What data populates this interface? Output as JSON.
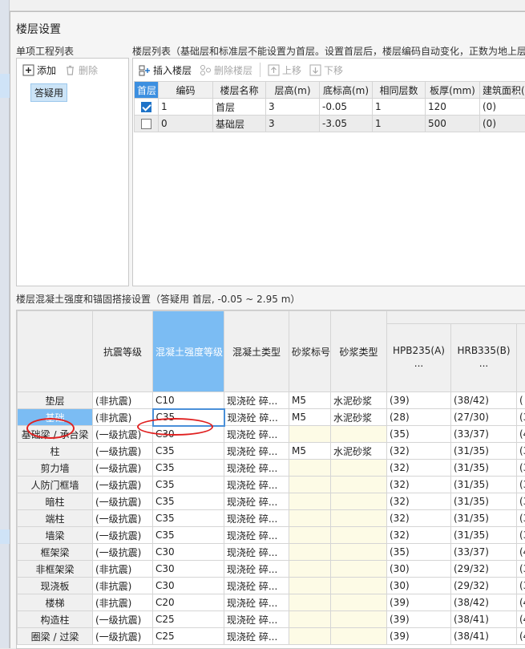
{
  "dialog": {
    "title": "楼层设置"
  },
  "project_list": {
    "label": "单项工程列表",
    "add_label": "添加",
    "delete_label": "删除",
    "items": [
      "答疑用"
    ]
  },
  "floor_list": {
    "label": "楼层列表（基础层和标准层不能设置为首层。设置首层后，楼层编码自动变化，正数为地上层",
    "insert_label": "插入楼层",
    "delete_label": "删除楼层",
    "up_label": "上移",
    "down_label": "下移",
    "columns": [
      "首层",
      "编码",
      "楼层名称",
      "层高(m)",
      "底标高(m)",
      "相同层数",
      "板厚(mm)",
      "建筑面积(m"
    ],
    "rows": [
      {
        "first": true,
        "code": "1",
        "name": "首层",
        "height": "3",
        "bottom": "-0.05",
        "same": "1",
        "slab": "120",
        "area": "(0)"
      },
      {
        "first": false,
        "code": "0",
        "name": "基础层",
        "height": "3",
        "bottom": "-3.05",
        "same": "1",
        "slab": "500",
        "area": "(0)"
      }
    ]
  },
  "concrete": {
    "label": "楼层混凝土强度和锚固搭接设置（答疑用  首层, -0.05 ~ 2.95 m）",
    "columns": [
      "抗震等级",
      "混凝土强度等级",
      "混凝土类型",
      "砂浆标号",
      "砂浆类型",
      "HPB235(A)\n...",
      "HRB335(B)\n..."
    ],
    "rows": [
      {
        "name": "垫层",
        "seismic": "(非抗震)",
        "grade": "C10",
        "type": "现浇砼 碎...",
        "mortar": "M5",
        "mortar_type": "水泥砂浆",
        "hpb": "(39)",
        "hrb": "(38/42)",
        "extra": "("
      },
      {
        "name": "基础",
        "seismic": "(非抗震)",
        "grade": "C35",
        "type": "现浇砼 碎...",
        "mortar": "M5",
        "mortar_type": "水泥砂浆",
        "hpb": "(28)",
        "hrb": "(27/30)",
        "extra": "(3"
      },
      {
        "name": "基础梁 / 承台梁",
        "seismic": "(一级抗震)",
        "grade": "C30",
        "type": "现浇砼 碎...",
        "mortar": "",
        "mortar_type": "",
        "hpb": "(35)",
        "hrb": "(33/37)",
        "extra": "(4"
      },
      {
        "name": "柱",
        "seismic": "(一级抗震)",
        "grade": "C35",
        "type": "现浇砼 碎...",
        "mortar": "M5",
        "mortar_type": "水泥砂浆",
        "hpb": "(32)",
        "hrb": "(31/35)",
        "extra": "(3"
      },
      {
        "name": "剪力墙",
        "seismic": "(一级抗震)",
        "grade": "C35",
        "type": "现浇砼 碎...",
        "mortar": "",
        "mortar_type": "",
        "hpb": "(32)",
        "hrb": "(31/35)",
        "extra": "(3"
      },
      {
        "name": "人防门框墙",
        "seismic": "(一级抗震)",
        "grade": "C35",
        "type": "现浇砼 碎...",
        "mortar": "",
        "mortar_type": "",
        "hpb": "(32)",
        "hrb": "(31/35)",
        "extra": "(3"
      },
      {
        "name": "暗柱",
        "seismic": "(一级抗震)",
        "grade": "C35",
        "type": "现浇砼 碎...",
        "mortar": "",
        "mortar_type": "",
        "hpb": "(32)",
        "hrb": "(31/35)",
        "extra": "(3"
      },
      {
        "name": "端柱",
        "seismic": "(一级抗震)",
        "grade": "C35",
        "type": "现浇砼 碎...",
        "mortar": "",
        "mortar_type": "",
        "hpb": "(32)",
        "hrb": "(31/35)",
        "extra": "(3"
      },
      {
        "name": "墙梁",
        "seismic": "(一级抗震)",
        "grade": "C35",
        "type": "现浇砼 碎...",
        "mortar": "",
        "mortar_type": "",
        "hpb": "(32)",
        "hrb": "(31/35)",
        "extra": "(3"
      },
      {
        "name": "框架梁",
        "seismic": "(一级抗震)",
        "grade": "C30",
        "type": "现浇砼 碎...",
        "mortar": "",
        "mortar_type": "",
        "hpb": "(35)",
        "hrb": "(33/37)",
        "extra": "(4"
      },
      {
        "name": "非框架梁",
        "seismic": "(非抗震)",
        "grade": "C30",
        "type": "现浇砼 碎...",
        "mortar": "",
        "mortar_type": "",
        "hpb": "(30)",
        "hrb": "(29/32)",
        "extra": "(3"
      },
      {
        "name": "现浇板",
        "seismic": "(非抗震)",
        "grade": "C30",
        "type": "现浇砼 碎...",
        "mortar": "",
        "mortar_type": "",
        "hpb": "(30)",
        "hrb": "(29/32)",
        "extra": "(3"
      },
      {
        "name": "楼梯",
        "seismic": "(非抗震)",
        "grade": "C20",
        "type": "现浇砼 碎...",
        "mortar": "",
        "mortar_type": "",
        "hpb": "(39)",
        "hrb": "(38/42)",
        "extra": "(4"
      },
      {
        "name": "构造柱",
        "seismic": "(一级抗震)",
        "grade": "C25",
        "type": "现浇砼 碎...",
        "mortar": "",
        "mortar_type": "",
        "hpb": "(39)",
        "hrb": "(38/41)",
        "extra": "(4"
      },
      {
        "name": "圈梁 / 过梁",
        "seismic": "(一级抗震)",
        "grade": "C25",
        "type": "现浇砼 碎...",
        "mortar": "",
        "mortar_type": "",
        "hpb": "(39)",
        "hrb": "(38/41)",
        "extra": "(4"
      }
    ]
  },
  "colors": {
    "accent": "#3c8fe0",
    "selected": "#7bbcf3",
    "annotation": "#e02020",
    "mortar_bg": "#fdfbe6"
  }
}
